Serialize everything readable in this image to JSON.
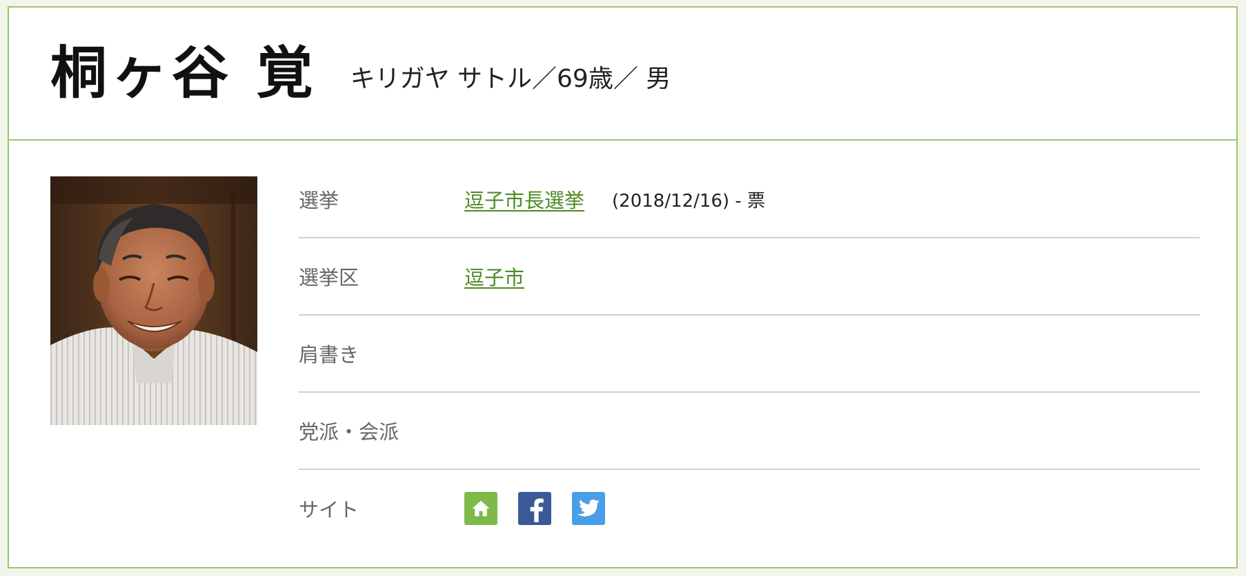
{
  "header": {
    "name": "桐ヶ谷 覚",
    "subinfo": "キリガヤ サトル／69歳／ 男"
  },
  "photo": {
    "icon": "candidate-portrait"
  },
  "rows": {
    "election": {
      "label": "選挙",
      "link": "逗子市長選挙",
      "meta": "(2018/12/16) - 票"
    },
    "district": {
      "label": "選挙区",
      "link": "逗子市"
    },
    "title": {
      "label": "肩書き",
      "value": ""
    },
    "party": {
      "label": "党派・会派",
      "value": ""
    },
    "site": {
      "label": "サイト",
      "icons": [
        "home-icon",
        "facebook-icon",
        "twitter-icon"
      ]
    }
  },
  "colors": {
    "accent_border": "#9cc76a",
    "link": "#4d8a26",
    "home": "#7dba4a",
    "facebook": "#3b5998",
    "twitter": "#4a9ee8"
  }
}
